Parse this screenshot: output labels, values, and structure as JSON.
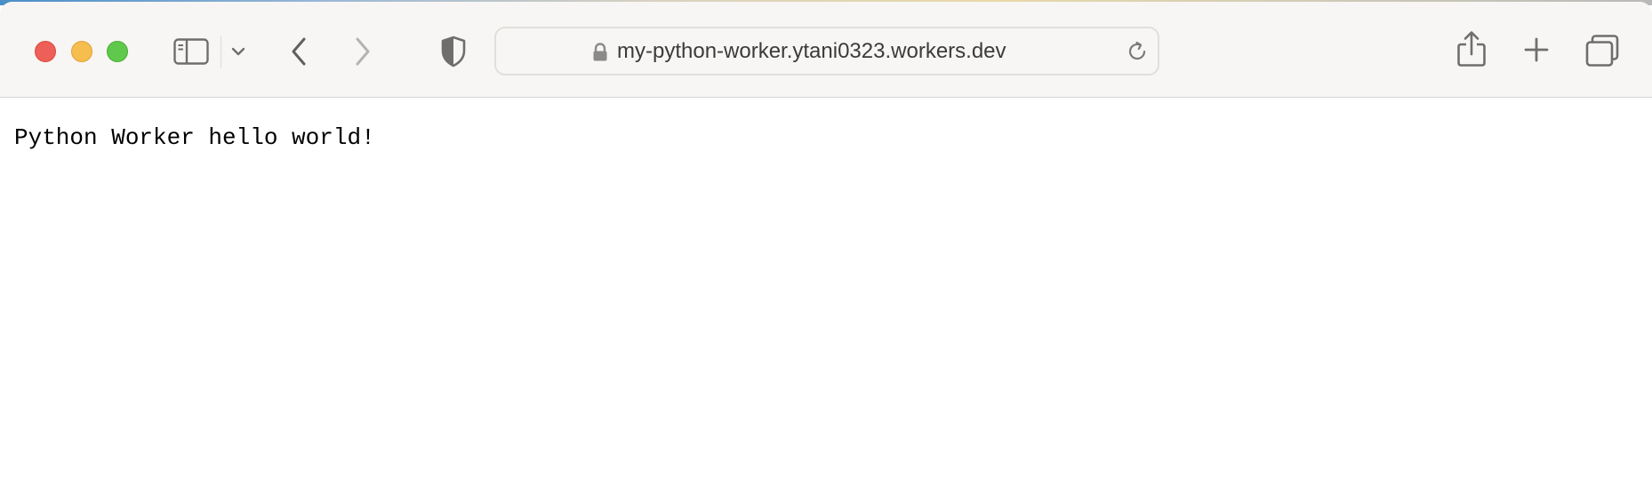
{
  "colors": {
    "close": "#ee5f57",
    "minimize": "#f5be4f",
    "maximize": "#5ec94a",
    "toolbar_bg": "#f8f6f4",
    "icon": "#6e6e6e"
  },
  "toolbar": {
    "icons": {
      "sidebar": "sidebar-icon",
      "sidebar_menu": "chevron-down-icon",
      "back": "chevron-left-icon",
      "forward": "chevron-right-icon",
      "privacy": "shield-icon",
      "share": "share-icon",
      "new_tab": "plus-icon",
      "tab_overview": "tabs-overview-icon"
    }
  },
  "address_bar": {
    "url": "my-python-worker.ytani0323.workers.dev",
    "secure_icon": "lock-icon",
    "reload_icon": "reload-icon"
  },
  "page": {
    "body_text": "Python Worker hello world!"
  }
}
